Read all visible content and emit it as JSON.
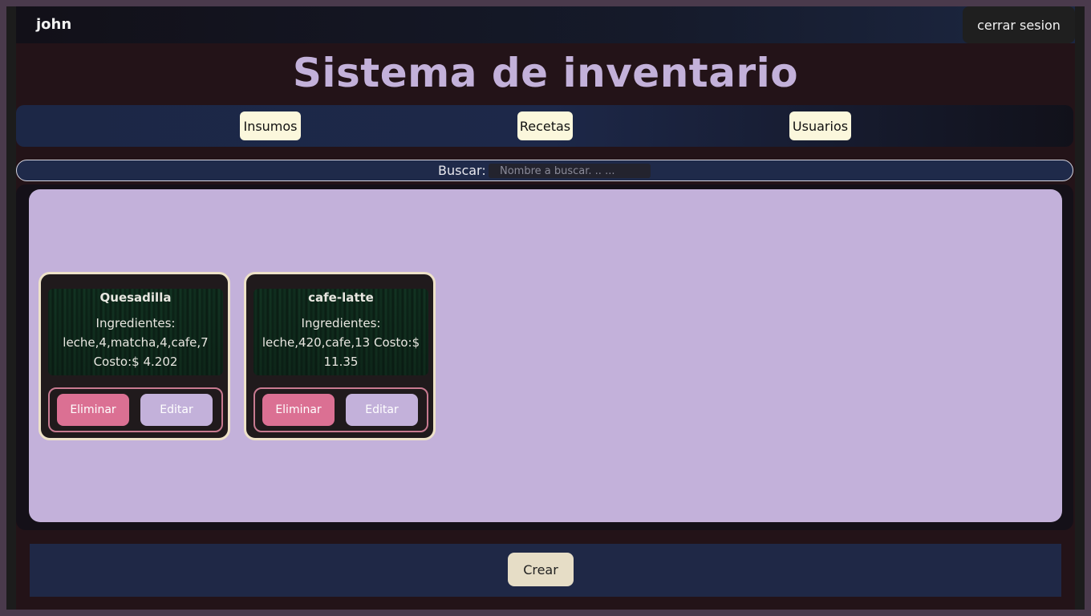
{
  "header": {
    "username": "john",
    "logout_label": "cerrar sesion"
  },
  "title": "Sistema de inventario",
  "nav": {
    "items": [
      {
        "label": "Insumos"
      },
      {
        "label": "Recetas"
      },
      {
        "label": "Usuarios"
      }
    ]
  },
  "search": {
    "label": "Buscar:",
    "placeholder": "Nombre a buscar. .. ...",
    "value": ""
  },
  "cards": [
    {
      "title": "Quesadilla",
      "description": "Ingredientes: leche,4,matcha,4,cafe,7 Costo:$ 4.202",
      "delete_label": "Eliminar",
      "edit_label": "Editar"
    },
    {
      "title": "cafe-latte",
      "description": "Ingredientes: leche,420,cafe,13 Costo:$ 11.35",
      "delete_label": "Eliminar",
      "edit_label": "Editar"
    }
  ],
  "footer": {
    "create_label": "Crear"
  },
  "colors": {
    "accent_lavender": "#c3b1da",
    "delete_pink": "#db7093",
    "nav_button_cream": "#fbf7dc",
    "navy": "#1f2846"
  }
}
